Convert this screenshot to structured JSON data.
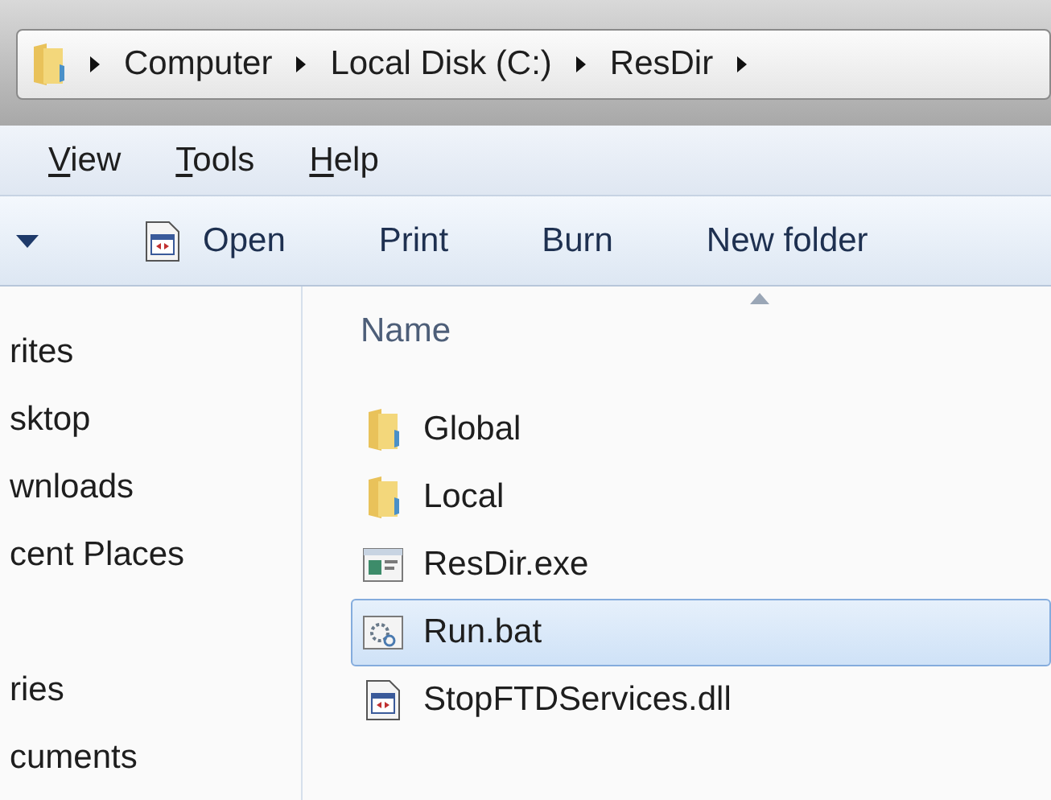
{
  "address_bar": {
    "crumbs": [
      "Computer",
      "Local Disk (C:)",
      "ResDir"
    ]
  },
  "menu_bar": [
    "View",
    "Tools",
    "Help"
  ],
  "toolbar": [
    {
      "kind": "dropdown"
    },
    {
      "kind": "open",
      "label": "Open"
    },
    {
      "kind": "plain",
      "label": "Print"
    },
    {
      "kind": "plain",
      "label": "Burn"
    },
    {
      "kind": "plain",
      "label": "New folder"
    }
  ],
  "navigation_pane": {
    "sections": [
      {
        "items": [
          "rites",
          "sktop",
          "wnloads",
          "cent Places"
        ]
      },
      {
        "items": [
          "ries",
          "cuments"
        ]
      }
    ]
  },
  "file_list": {
    "column": "Name",
    "files": [
      {
        "name": "Global",
        "kind": "folder",
        "selected": false
      },
      {
        "name": "Local",
        "kind": "folder",
        "selected": false
      },
      {
        "name": "ResDir.exe",
        "kind": "exe",
        "selected": false
      },
      {
        "name": "Run.bat",
        "kind": "bat",
        "selected": true
      },
      {
        "name": "StopFTDServices.dll",
        "kind": "dll",
        "selected": false
      }
    ]
  }
}
